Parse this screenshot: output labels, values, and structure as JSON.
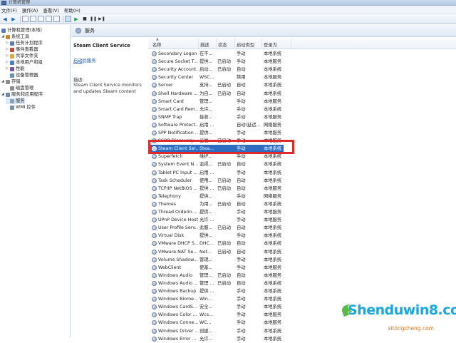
{
  "window": {
    "title": "计算机管理"
  },
  "menu": [
    "文件(F)",
    "操作(A)",
    "查看(V)",
    "帮助(H)"
  ],
  "tree": {
    "root": "计算机管理(本地)",
    "nodes": [
      {
        "label": "系统工具",
        "level": 1,
        "expanded": true,
        "icon_color": "#c58a2a"
      },
      {
        "label": "任务计划程序",
        "level": 2,
        "expanded": false,
        "icon_color": "#5b7db0"
      },
      {
        "label": "事件查看器",
        "level": 2,
        "expanded": false,
        "icon_color": "#c24b3a"
      },
      {
        "label": "共享文件夹",
        "level": 2,
        "expanded": false,
        "icon_color": "#d8a93a"
      },
      {
        "label": "本地用户和组",
        "level": 2,
        "expanded": false,
        "icon_color": "#4f7bbf"
      },
      {
        "label": "性能",
        "level": 2,
        "expanded": false,
        "icon_color": "#7a56a8"
      },
      {
        "label": "设备管理器",
        "level": 2,
        "expanded": null,
        "icon_color": "#6a8fb7"
      },
      {
        "label": "存储",
        "level": 1,
        "expanded": true,
        "icon_color": "#8c8c8c"
      },
      {
        "label": "磁盘管理",
        "level": 2,
        "expanded": null,
        "icon_color": "#8c8c8c"
      },
      {
        "label": "服务和应用程序",
        "level": 1,
        "expanded": true,
        "icon_color": "#6e88a8"
      },
      {
        "label": "服务",
        "level": 2,
        "expanded": null,
        "icon_color": "#8aa0bb",
        "selected": true
      },
      {
        "label": "WMI 控件",
        "level": 2,
        "expanded": null,
        "icon_color": "#7b8fa6"
      }
    ]
  },
  "panel": {
    "title": "服务",
    "service_name": "Steam Client Service",
    "link_prefix": "启动",
    "link_suffix": "此服务",
    "desc_label": "描述:",
    "description": "Steam Client Service monitors and updates Steam content"
  },
  "columns": [
    "名称",
    "描述",
    "状态",
    "启动类型",
    "登录为"
  ],
  "services": [
    {
      "name": "Secondary Logon",
      "desc": "在不...",
      "status": "",
      "startup": "手动",
      "logon": "本地系统"
    },
    {
      "name": "Secure Socket T...",
      "desc": "提供...",
      "status": "已启动",
      "startup": "手动",
      "logon": "本地服务"
    },
    {
      "name": "Security Account...",
      "desc": "启动...",
      "status": "已启动",
      "startup": "自动",
      "logon": "本地系统"
    },
    {
      "name": "Security Center",
      "desc": "WSC...",
      "status": "",
      "startup": "禁用",
      "logon": "本地服务"
    },
    {
      "name": "Server",
      "desc": "支持...",
      "status": "已启动",
      "startup": "自动",
      "logon": "本地系统"
    },
    {
      "name": "Shell Hardware ...",
      "desc": "为自...",
      "status": "已启动",
      "startup": "自动",
      "logon": "本地系统"
    },
    {
      "name": "Smart Card",
      "desc": "管理...",
      "status": "",
      "startup": "手动",
      "logon": "本地服务"
    },
    {
      "name": "Smart Card Rem...",
      "desc": "允许...",
      "status": "",
      "startup": "手动",
      "logon": "本地系统"
    },
    {
      "name": "SNMP Trap",
      "desc": "接收...",
      "status": "",
      "startup": "手动",
      "logon": "本地服务"
    },
    {
      "name": "Software Protect...",
      "desc": "启用 ...",
      "status": "",
      "startup": "自动(延迟...",
      "logon": "网络服务"
    },
    {
      "name": "SPP Notification ...",
      "desc": "提供...",
      "status": "",
      "startup": "手动",
      "logon": "本地服务"
    },
    {
      "name": "SSDP Discovery",
      "desc": "当发...",
      "status": "已启动",
      "startup": "手动",
      "logon": "本地服务"
    },
    {
      "name": "Steam Client Ser...",
      "desc": "Stea...",
      "status": "",
      "startup": "手动",
      "logon": "本地系统",
      "selected": true
    },
    {
      "name": "Superfetch",
      "desc": "维护...",
      "status": "",
      "startup": "手动",
      "logon": "本地系统"
    },
    {
      "name": "System Event N...",
      "desc": "监视...",
      "status": "已启动",
      "startup": "自动",
      "logon": "本地系统"
    },
    {
      "name": "Tablet PC Input ...",
      "desc": "启用 ...",
      "status": "",
      "startup": "手动",
      "logon": "本地系统"
    },
    {
      "name": "Task Scheduler",
      "desc": "使用...",
      "status": "已启动",
      "startup": "自动",
      "logon": "本地系统"
    },
    {
      "name": "TCP/IP NetBIOS ...",
      "desc": "提供 ...",
      "status": "已启动",
      "startup": "自动",
      "logon": "本地服务"
    },
    {
      "name": "Telephony",
      "desc": "提供...",
      "status": "",
      "startup": "手动",
      "logon": "网络服务"
    },
    {
      "name": "Themes",
      "desc": "为用...",
      "status": "已启动",
      "startup": "自动",
      "logon": "本地系统"
    },
    {
      "name": "Thread Orderin...",
      "desc": "提供...",
      "status": "",
      "startup": "手动",
      "logon": "本地服务"
    },
    {
      "name": "UPnP Device Host",
      "desc": "允许 ...",
      "status": "",
      "startup": "手动",
      "logon": "本地服务"
    },
    {
      "name": "User Profile Serv...",
      "desc": "此服...",
      "status": "已启动",
      "startup": "自动",
      "logon": "本地系统"
    },
    {
      "name": "Virtual Disk",
      "desc": "提供...",
      "status": "",
      "startup": "手动",
      "logon": "本地系统"
    },
    {
      "name": "VMware DHCP S...",
      "desc": "DHC...",
      "status": "已启动",
      "startup": "自动",
      "logon": "本地系统"
    },
    {
      "name": "VMware NAT Se...",
      "desc": "Net...",
      "status": "已启动",
      "startup": "自动",
      "logon": "本地系统"
    },
    {
      "name": "Volume Shadow...",
      "desc": "管理...",
      "status": "",
      "startup": "手动",
      "logon": "本地系统"
    },
    {
      "name": "WebClient",
      "desc": "使基...",
      "status": "",
      "startup": "手动",
      "logon": "本地服务"
    },
    {
      "name": "Windows Audio",
      "desc": "管理...",
      "status": "已启动",
      "startup": "自动",
      "logon": "本地服务"
    },
    {
      "name": "Windows Audio ...",
      "desc": "管理 ...",
      "status": "已启动",
      "startup": "自动",
      "logon": "本地系统"
    },
    {
      "name": "Windows Backup",
      "desc": "提供 ...",
      "status": "",
      "startup": "手动",
      "logon": "本地系统"
    },
    {
      "name": "Windows Biome...",
      "desc": "Win...",
      "status": "",
      "startup": "手动",
      "logon": "本地系统"
    },
    {
      "name": "Windows CardS...",
      "desc": "安全...",
      "status": "",
      "startup": "手动",
      "logon": "本地系统"
    },
    {
      "name": "Windows Color ...",
      "desc": "Wcs...",
      "status": "",
      "startup": "手动",
      "logon": "本地服务"
    },
    {
      "name": "Windows Conne...",
      "desc": "WC...",
      "status": "",
      "startup": "手动",
      "logon": "本地服务"
    },
    {
      "name": "Windows Driver ...",
      "desc": "创建...",
      "status": "",
      "startup": "手动",
      "logon": "本地系统"
    },
    {
      "name": "Windows Error ...",
      "desc": "允许...",
      "status": "",
      "startup": "手动",
      "logon": "本地系统"
    }
  ],
  "watermark": {
    "brand": "Shenduwin8.com",
    "site": "xitongcheng.com"
  },
  "colors": {
    "selection": "#2d6cc1",
    "highlight_box": "#e02b2b",
    "watermark_blue": "#1aa7e0",
    "watermark_orange": "#e1761c"
  }
}
